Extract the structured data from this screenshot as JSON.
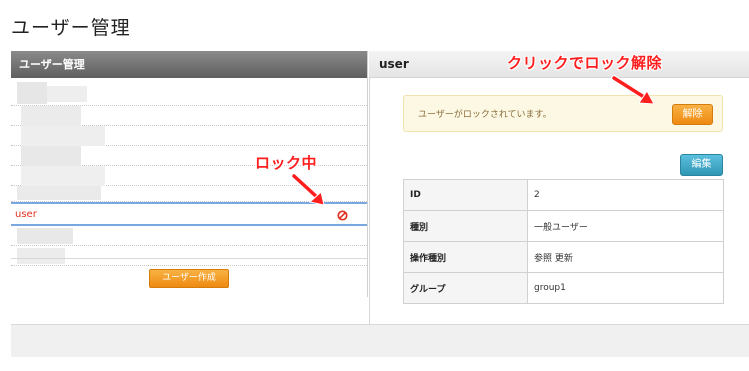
{
  "page": {
    "title": "ユーザー管理"
  },
  "left_panel": {
    "header": "ユーザー管理",
    "selected_user": "user",
    "create_button": "ユーザー作成"
  },
  "right_panel": {
    "header": "user",
    "alert": {
      "message": "ユーザーがロックされています。",
      "unlock_button": "解除"
    },
    "edit_button": "編集",
    "details": [
      {
        "key": "ID",
        "value": "2"
      },
      {
        "key": "種別",
        "value": "一般ユーザー"
      },
      {
        "key": "操作種別",
        "value": "参照 更新"
      },
      {
        "key": "グループ",
        "value": "group1"
      }
    ]
  },
  "annotations": {
    "locked_label": "ロック中",
    "unlock_hint": "クリックでロック解除"
  },
  "icons": {
    "lock_status": "no-entry-icon"
  },
  "colors": {
    "accent_orange": "#ee8a12",
    "info_blue": "#2f96b4",
    "locked_red": "#e0301e",
    "annotation_red": "#ff1e1e"
  }
}
